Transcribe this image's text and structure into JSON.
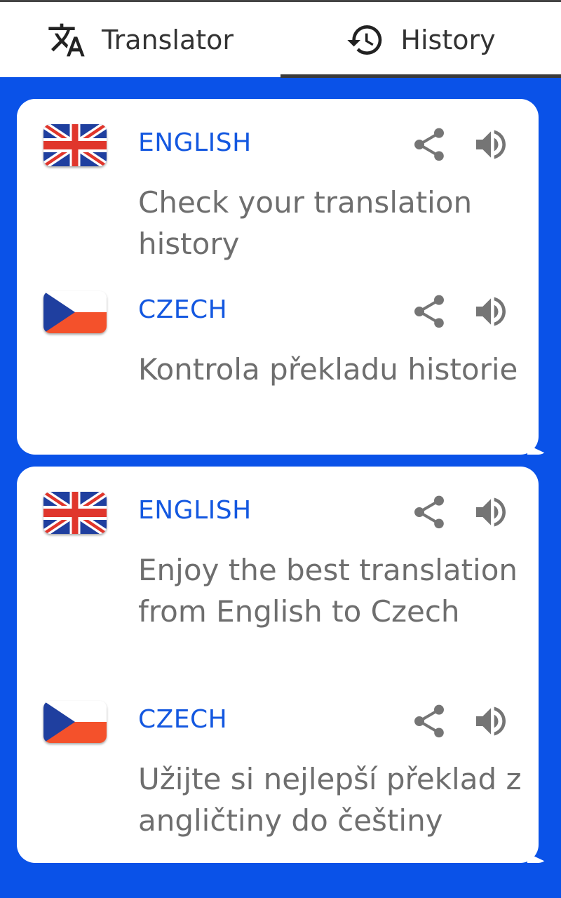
{
  "tabs": {
    "translator_label": "Translator",
    "history_label": "History",
    "active": "History"
  },
  "colors": {
    "background": "#0a52e8",
    "language_label": "#1458e0",
    "body_text": "#6e6e6e"
  },
  "history": [
    {
      "source": {
        "flag": "uk-flag",
        "language": "ENGLISH",
        "text": "Check your translation history"
      },
      "target": {
        "flag": "czech-flag",
        "language": "CZECH",
        "text": "Kontrola překladu historie"
      }
    },
    {
      "source": {
        "flag": "uk-flag",
        "language": "ENGLISH",
        "text": "Enjoy the best translation from English to Czech"
      },
      "target": {
        "flag": "czech-flag",
        "language": "CZECH",
        "text": "Užijte si nejlepší překlad z angličtiny do češtiny"
      }
    }
  ]
}
